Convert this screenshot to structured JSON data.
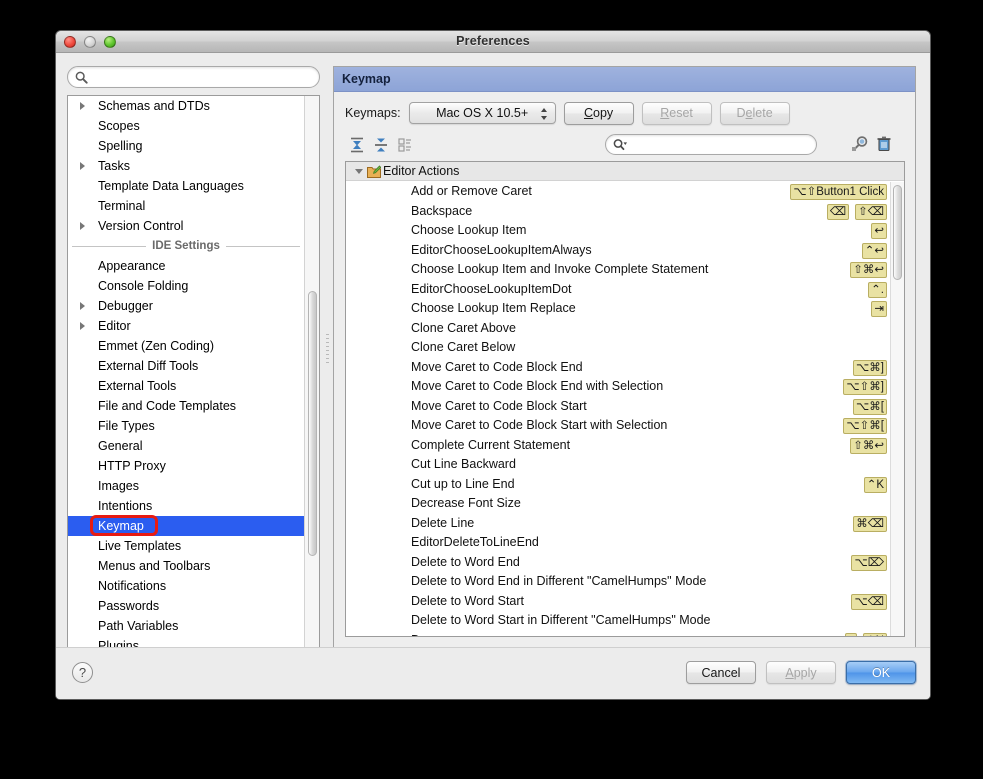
{
  "window": {
    "title": "Preferences",
    "traffic_lights": [
      "close",
      "minimize",
      "zoom"
    ]
  },
  "sidebar": {
    "search_placeholder": "",
    "search_value": "",
    "items": [
      {
        "label": "Schemas and DTDs",
        "expandable": true
      },
      {
        "label": "Scopes",
        "expandable": false
      },
      {
        "label": "Spelling",
        "expandable": false
      },
      {
        "label": "Tasks",
        "expandable": true
      },
      {
        "label": "Template Data Languages",
        "expandable": false
      },
      {
        "label": "Terminal",
        "expandable": false
      },
      {
        "label": "Version Control",
        "expandable": true
      }
    ],
    "separator_label": "IDE Settings",
    "ide_items": [
      {
        "label": "Appearance",
        "expandable": false
      },
      {
        "label": "Console Folding",
        "expandable": false
      },
      {
        "label": "Debugger",
        "expandable": true
      },
      {
        "label": "Editor",
        "expandable": true
      },
      {
        "label": "Emmet (Zen Coding)",
        "expandable": false
      },
      {
        "label": "External Diff Tools",
        "expandable": false
      },
      {
        "label": "External Tools",
        "expandable": false
      },
      {
        "label": "File and Code Templates",
        "expandable": false
      },
      {
        "label": "File Types",
        "expandable": false
      },
      {
        "label": "General",
        "expandable": false
      },
      {
        "label": "HTTP Proxy",
        "expandable": false
      },
      {
        "label": "Images",
        "expandable": false
      },
      {
        "label": "Intentions",
        "expandable": false
      },
      {
        "label": "Keymap",
        "expandable": false,
        "selected": true,
        "annotated": true
      },
      {
        "label": "Live Templates",
        "expandable": false
      },
      {
        "label": "Menus and Toolbars",
        "expandable": false
      },
      {
        "label": "Notifications",
        "expandable": false
      },
      {
        "label": "Passwords",
        "expandable": false
      },
      {
        "label": "Path Variables",
        "expandable": false
      },
      {
        "label": "Plugins",
        "expandable": false
      }
    ],
    "annotation_color": "#e81b12",
    "selection_color": "#2b5df0"
  },
  "panel": {
    "header_title": "Keymap",
    "keymaps_label": "Keymaps:",
    "keymaps_selected": "Mac OS X 10.5+",
    "buttons": [
      {
        "label": "Copy",
        "enabled": true,
        "mnemonic": "C"
      },
      {
        "label": "Reset",
        "enabled": false,
        "mnemonic": "R"
      },
      {
        "label": "Delete",
        "enabled": false,
        "mnemonic": "e"
      }
    ],
    "toolbar_icons": [
      {
        "name": "expand-all-icon"
      },
      {
        "name": "collapse-all-icon"
      },
      {
        "name": "edit-shortcut-icon"
      }
    ],
    "filter_placeholder": "",
    "filter_value": "",
    "right_icons": [
      {
        "name": "find-by-shortcut-icon"
      },
      {
        "name": "delete-shortcut-icon"
      }
    ]
  },
  "actions": {
    "group_label": "Editor Actions",
    "group_expanded": true,
    "rows": [
      {
        "name": "Add or Remove Caret",
        "shortcuts": [
          "⌥⇧Button1 Click"
        ]
      },
      {
        "name": "Backspace",
        "shortcuts": [
          "⌫",
          "⇧⌫"
        ]
      },
      {
        "name": "Choose Lookup Item",
        "shortcuts": [
          "↩"
        ]
      },
      {
        "name": "EditorChooseLookupItemAlways",
        "shortcuts": [
          "⌃↩"
        ]
      },
      {
        "name": "Choose Lookup Item and Invoke Complete Statement",
        "shortcuts": [
          "⇧⌘↩"
        ]
      },
      {
        "name": "EditorChooseLookupItemDot",
        "shortcuts": [
          "⌃."
        ]
      },
      {
        "name": "Choose Lookup Item Replace",
        "shortcuts": [
          "⇥"
        ]
      },
      {
        "name": "Clone Caret Above",
        "shortcuts": []
      },
      {
        "name": "Clone Caret Below",
        "shortcuts": []
      },
      {
        "name": "Move Caret to Code Block End",
        "shortcuts": [
          "⌥⌘]"
        ]
      },
      {
        "name": "Move Caret to Code Block End with Selection",
        "shortcuts": [
          "⌥⇧⌘]"
        ]
      },
      {
        "name": "Move Caret to Code Block Start",
        "shortcuts": [
          "⌥⌘["
        ]
      },
      {
        "name": "Move Caret to Code Block Start with Selection",
        "shortcuts": [
          "⌥⇧⌘["
        ]
      },
      {
        "name": "Complete Current Statement",
        "shortcuts": [
          "⇧⌘↩"
        ]
      },
      {
        "name": "Cut Line Backward",
        "shortcuts": []
      },
      {
        "name": "Cut up to Line End",
        "shortcuts": [
          "⌃K"
        ]
      },
      {
        "name": "Decrease Font Size",
        "shortcuts": []
      },
      {
        "name": "Delete Line",
        "shortcuts": [
          "⌘⌫"
        ]
      },
      {
        "name": "EditorDeleteToLineEnd",
        "shortcuts": []
      },
      {
        "name": "Delete to Word End",
        "shortcuts": [
          "⌥⌦"
        ]
      },
      {
        "name": "Delete to Word End in Different \"CamelHumps\" Mode",
        "shortcuts": []
      },
      {
        "name": "Delete to Word Start",
        "shortcuts": [
          "⌥⌫"
        ]
      },
      {
        "name": "Delete to Word Start in Different \"CamelHumps\" Mode",
        "shortcuts": []
      },
      {
        "name": "Down",
        "shortcuts": [
          "↓",
          "⌃N"
        ]
      }
    ],
    "shortcut_badge_color": "#e9e2a3"
  },
  "footer": {
    "help_label": "?",
    "cancel_label": "Cancel",
    "apply_label": "Apply",
    "apply_enabled": false,
    "ok_label": "OK",
    "ok_primary": true
  }
}
